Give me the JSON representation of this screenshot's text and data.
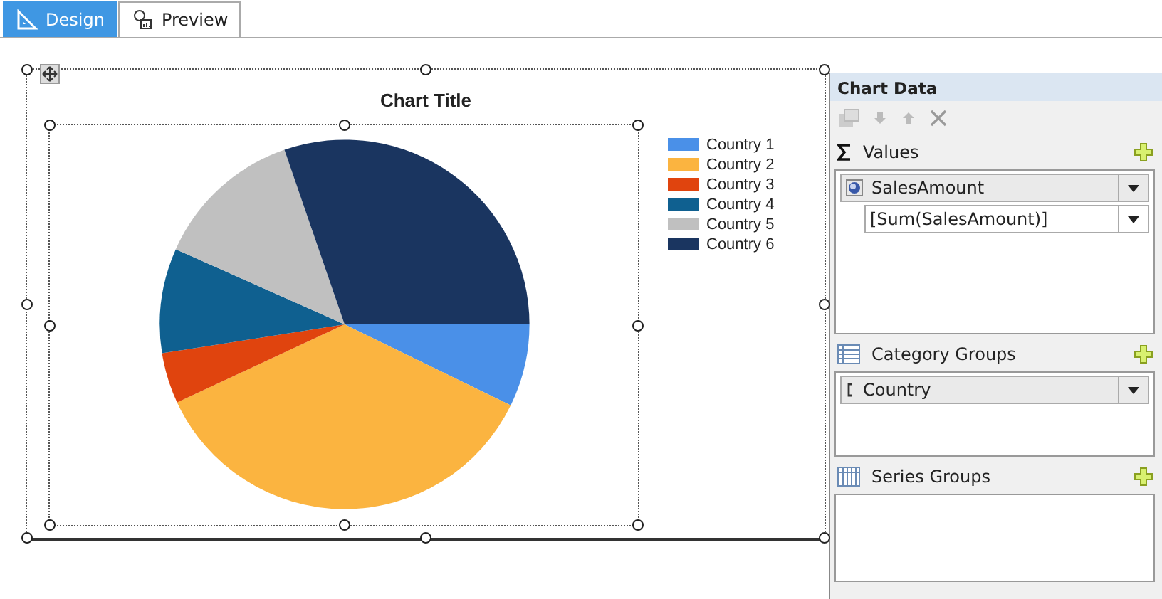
{
  "tabs": [
    {
      "label": "Design",
      "selected": true,
      "kind": "design"
    },
    {
      "label": "Preview",
      "selected": false,
      "kind": "preview"
    }
  ],
  "chart": {
    "title": "Chart Title",
    "legend": [
      {
        "label": "Country 1",
        "color": "#4a90e8"
      },
      {
        "label": "Country 2",
        "color": "#fbb440"
      },
      {
        "label": "Country 3",
        "color": "#e0440e"
      },
      {
        "label": "Country 4",
        "color": "#0f6090"
      },
      {
        "label": "Country 5",
        "color": "#c0c0c0"
      },
      {
        "label": "Country 6",
        "color": "#1a3560"
      }
    ]
  },
  "chart_data_panel": {
    "title": "Chart Data",
    "sections": [
      {
        "kind": "values",
        "title": "Values",
        "fields": [
          {
            "kind": "measure",
            "label": "SalesAmount"
          },
          {
            "kind": "expression",
            "label": "[Sum(SalesAmount)]"
          }
        ]
      },
      {
        "kind": "category",
        "title": "Category Groups",
        "fields": [
          {
            "kind": "group",
            "label": "Country"
          }
        ]
      },
      {
        "kind": "series",
        "title": "Series Groups"
      }
    ]
  }
}
